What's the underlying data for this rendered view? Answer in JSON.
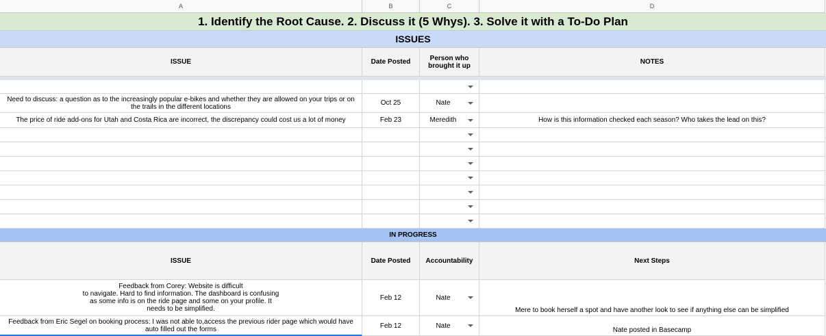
{
  "columns": [
    "A",
    "B",
    "C",
    "D"
  ],
  "title": "1. Identify the Root Cause. 2. Discuss it (5 Whys). 3. Solve it with a To-Do Plan",
  "issues": {
    "band_label": "ISSUES",
    "headers": {
      "issue": "ISSUE",
      "date": "Date Posted",
      "person": "Person who brought it up",
      "notes": "NOTES"
    },
    "rows": [
      {
        "issue": "",
        "date": "",
        "person": "",
        "notes": ""
      },
      {
        "issue": "Need to discuss: a question as to the increasingly popular e-bikes and whether they are allowed on your trips or on the trails in the different locations",
        "date": "Oct 25",
        "person": "Nate",
        "notes": ""
      },
      {
        "issue": "The price of ride add-ons for Utah and Costa Rica are incorrect, the discrepancy could cost us a lot of money",
        "date": "Feb 23",
        "person": "Meredith",
        "notes": "How is this information checked each season? Who takes the lead on this?"
      },
      {
        "issue": "",
        "date": "",
        "person": "",
        "notes": ""
      },
      {
        "issue": "",
        "date": "",
        "person": "",
        "notes": ""
      },
      {
        "issue": "",
        "date": "",
        "person": "",
        "notes": ""
      },
      {
        "issue": "",
        "date": "",
        "person": "",
        "notes": ""
      },
      {
        "issue": "",
        "date": "",
        "person": "",
        "notes": ""
      },
      {
        "issue": "",
        "date": "",
        "person": "",
        "notes": ""
      }
    ]
  },
  "in_progress": {
    "band_label": "IN PROGRESS",
    "headers": {
      "issue": "ISSUE",
      "date": "Date Posted",
      "accountability": "Accountability",
      "next_steps": "Next Steps"
    },
    "rows": [
      {
        "issue_lines": [
          "Feedback from Corey: Website is difficult",
          "to navigate. Hard to find information. The dashboard is confusing",
          "as some info is on the ride page and some on your profile.  It",
          "needs to be simplified."
        ],
        "date": "Feb 12",
        "person": "Nate",
        "next_steps": "Mere to book herself a spot and have another look to see if anything else can be simplified"
      },
      {
        "issue": "Feedback from Eric Segel on booking process: I was not able to,access the previous rider page which would have auto filled out the forms",
        "date": "Feb 12",
        "person": "Nate",
        "next_steps": "Nate posted in Basecamp"
      }
    ]
  }
}
